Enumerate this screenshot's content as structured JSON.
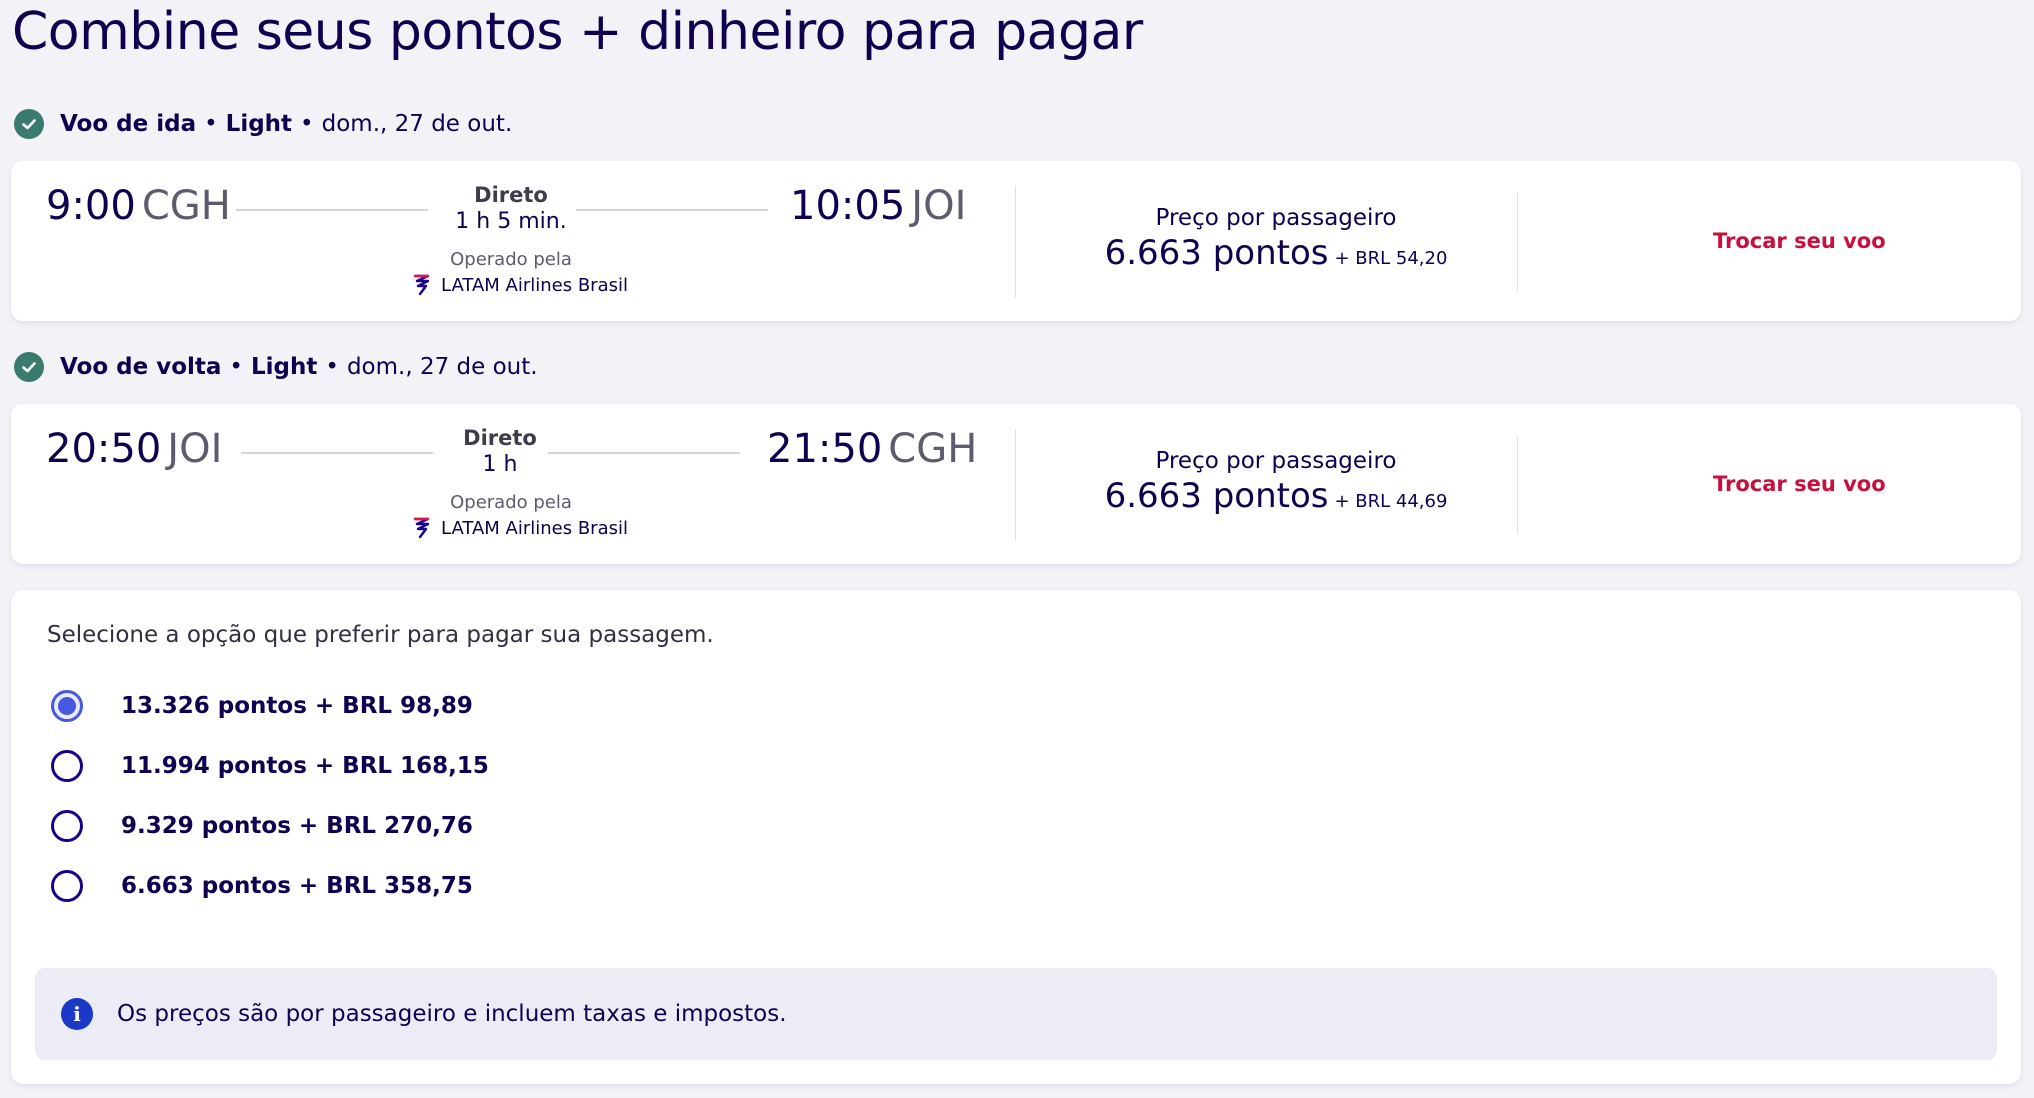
{
  "page": {
    "title": "Combine seus pontos + dinheiro para pagar"
  },
  "legs": [
    {
      "header": {
        "title": "Voo de ida",
        "fare": "Light",
        "date": "dom., 27 de out."
      },
      "departure": {
        "time": "9:00",
        "code": "CGH"
      },
      "arrival": {
        "time": "10:05",
        "code": "JOI"
      },
      "stops": "Direto",
      "duration": "1 h 5 min.",
      "operated_label": "Operado pela",
      "airline": "LATAM Airlines Brasil",
      "price_label": "Preço por passageiro",
      "price_points": "6.663 pontos",
      "price_cash": "+ BRL 54,20",
      "change_label": "Trocar seu voo"
    },
    {
      "header": {
        "title": "Voo de volta",
        "fare": "Light",
        "date": "dom., 27 de out."
      },
      "departure": {
        "time": "20:50",
        "code": "JOI"
      },
      "arrival": {
        "time": "21:50",
        "code": "CGH"
      },
      "stops": "Direto",
      "duration": "1 h",
      "operated_label": "Operado pela",
      "airline": "LATAM Airlines Brasil",
      "price_label": "Preço por passageiro",
      "price_points": "6.663 pontos",
      "price_cash": "+ BRL 44,69",
      "change_label": "Trocar seu voo"
    }
  ],
  "payment": {
    "intro": "Selecione a opção que preferir para pagar sua passagem.",
    "options": [
      {
        "label": "13.326 pontos + BRL 98,89",
        "selected": true
      },
      {
        "label": "11.994 pontos + BRL 168,15",
        "selected": false
      },
      {
        "label": "9.329 pontos + BRL 270,76",
        "selected": false
      },
      {
        "label": "6.663 pontos + BRL 358,75",
        "selected": false
      }
    ],
    "info": "Os preços são por passageiro e incluem taxas e impostos."
  },
  "colors": {
    "brand_navy": "#10004f",
    "accent_red": "#c8103e",
    "radio_blue": "#4658df",
    "check_green": "#3a7b6e",
    "info_blue": "#1b38c8"
  },
  "icons": {
    "check": "check-circle-icon",
    "airline": "latam-logo-icon",
    "info": "info-icon",
    "radio": "radio-button"
  }
}
